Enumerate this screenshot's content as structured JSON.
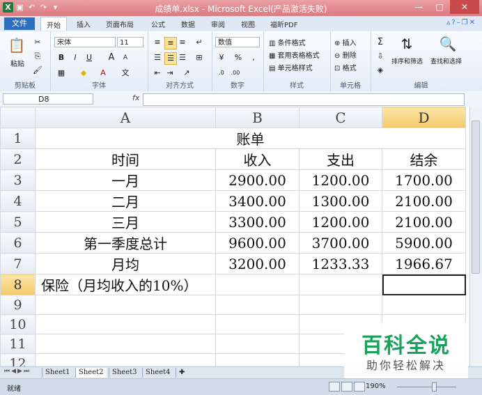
{
  "window": {
    "title": "成绩单.xlsx - Microsoft Excel(产品激活失败)"
  },
  "ribbon_tabs": [
    "开始",
    "插入",
    "页面布局",
    "公式",
    "数据",
    "审阅",
    "视图",
    "福昕PDF"
  ],
  "file_tab": "文件",
  "ribbon": {
    "clipboard": {
      "label": "剪贴板",
      "paste": "粘贴"
    },
    "font": {
      "label": "字体",
      "name": "宋体",
      "size": "11",
      "bold": "B",
      "italic": "I",
      "underline": "U",
      "grow": "A",
      "shrink": "A"
    },
    "alignment": {
      "label": "对齐方式"
    },
    "number": {
      "label": "数字",
      "format": "数值",
      "percent": "%"
    },
    "styles": {
      "label": "样式",
      "cond": "条件格式",
      "table": "套用表格格式",
      "cell": "单元格样式"
    },
    "cells": {
      "label": "单元格",
      "insert": "插入",
      "delete": "删除",
      "format": "格式"
    },
    "editing": {
      "label": "编辑",
      "sort": "排序和筛选",
      "find": "查找和选择"
    }
  },
  "formula_bar": {
    "name_box": "D8",
    "fx": "fx",
    "value": ""
  },
  "columns": [
    {
      "letter": "A",
      "selected": false
    },
    {
      "letter": "B",
      "selected": false
    },
    {
      "letter": "C",
      "selected": false
    },
    {
      "letter": "D",
      "selected": true
    }
  ],
  "rows": [
    {
      "num": "1",
      "cells": [
        "账单",
        "",
        "",
        ""
      ],
      "merged_title": true
    },
    {
      "num": "2",
      "cells": [
        "时间",
        "收入",
        "支出",
        "结余"
      ]
    },
    {
      "num": "3",
      "cells": [
        "一月",
        "2900.00",
        "1200.00",
        "1700.00"
      ]
    },
    {
      "num": "4",
      "cells": [
        "二月",
        "3400.00",
        "1300.00",
        "2100.00"
      ]
    },
    {
      "num": "5",
      "cells": [
        "三月",
        "3300.00",
        "1200.00",
        "2100.00"
      ]
    },
    {
      "num": "6",
      "cells": [
        "第一季度总计",
        "9600.00",
        "3700.00",
        "5900.00"
      ]
    },
    {
      "num": "7",
      "cells": [
        "月均",
        "3200.00",
        "1233.33",
        "1966.67"
      ]
    },
    {
      "num": "8",
      "cells": [
        "保险（月均收入的10%）",
        "",
        "",
        ""
      ],
      "selected": true
    },
    {
      "num": "9",
      "cells": [
        "",
        "",
        "",
        ""
      ]
    },
    {
      "num": "10",
      "cells": [
        "",
        "",
        "",
        ""
      ]
    },
    {
      "num": "11",
      "cells": [
        "",
        "",
        "",
        ""
      ]
    },
    {
      "num": "12",
      "cells": [
        "",
        "",
        "",
        ""
      ]
    }
  ],
  "active_cell": "D8",
  "sheet_tabs": [
    {
      "name": "Sheet1",
      "active": false
    },
    {
      "name": "Sheet2",
      "active": true
    },
    {
      "name": "Sheet3",
      "active": false
    },
    {
      "name": "Sheet4",
      "active": false
    }
  ],
  "status": {
    "text": "就绪",
    "zoom": "190%"
  },
  "watermark": {
    "title": "百科全说",
    "subtitle": "助你轻松解决"
  }
}
